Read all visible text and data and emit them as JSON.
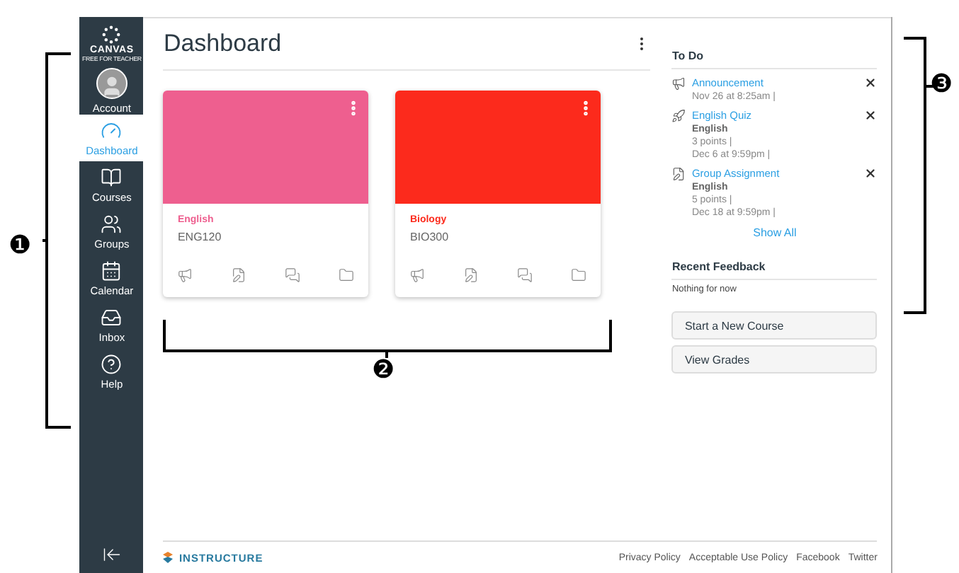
{
  "brand": {
    "name": "CANVAS",
    "tagline": "FREE FOR TEACHER"
  },
  "nav": [
    {
      "label": "Account",
      "selected": false
    },
    {
      "label": "Dashboard",
      "selected": true
    },
    {
      "label": "Courses",
      "selected": false
    },
    {
      "label": "Groups",
      "selected": false
    },
    {
      "label": "Calendar",
      "selected": false
    },
    {
      "label": "Inbox",
      "selected": false
    },
    {
      "label": "Help",
      "selected": false
    }
  ],
  "page_title": "Dashboard",
  "cards": [
    {
      "name": "English",
      "code": "ENG120",
      "color": "#ee5f8f"
    },
    {
      "name": "Biology",
      "code": "BIO300",
      "color": "#fc2a1c"
    }
  ],
  "todo": {
    "title": "To Do",
    "items": [
      {
        "kind": "announcement",
        "title": "Announcement",
        "lines": [
          "Nov 26 at 8:25am |"
        ]
      },
      {
        "kind": "quiz",
        "title": "English Quiz",
        "course": "English",
        "lines": [
          "3 points |",
          "Dec 6 at 9:59pm |"
        ]
      },
      {
        "kind": "assignment",
        "title": "Group Assignment",
        "course": "English",
        "lines": [
          "5 points |",
          "Dec 18 at 9:59pm |"
        ]
      }
    ],
    "show_all": "Show All"
  },
  "feedback": {
    "title": "Recent Feedback",
    "text": "Nothing for now"
  },
  "buttons": [
    "Start a New Course",
    "View Grades"
  ],
  "footer": {
    "brand": "INSTRUCTURE",
    "links": [
      "Privacy Policy",
      "Acceptable Use Policy",
      "Facebook",
      "Twitter"
    ]
  },
  "callouts": [
    {
      "marker": "❶"
    },
    {
      "marker": "❷"
    },
    {
      "marker": "❸"
    }
  ]
}
